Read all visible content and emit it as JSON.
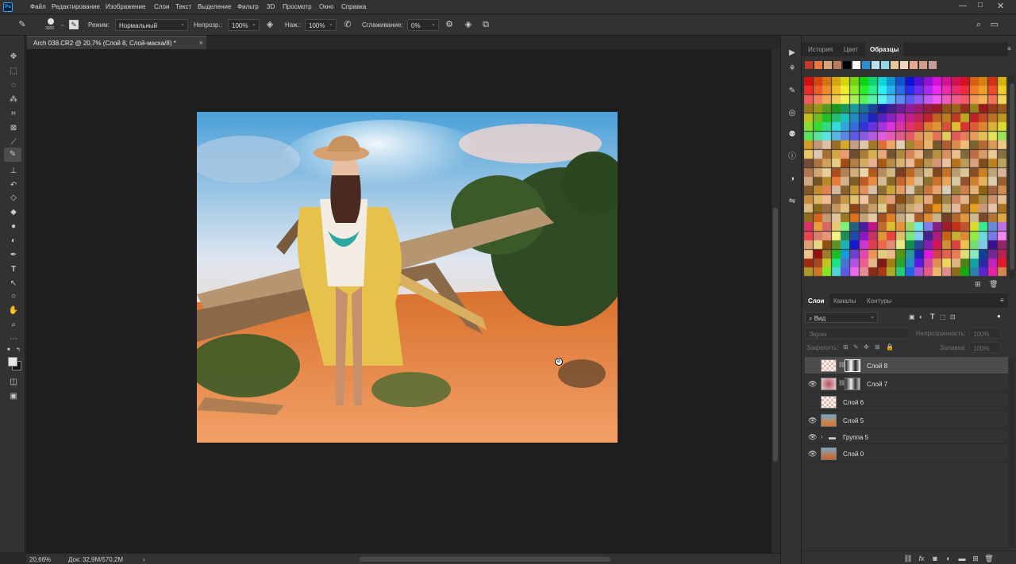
{
  "menubar": {
    "app_icon": "Ps",
    "items": [
      "Файл",
      "Редактирование",
      "Изображение",
      "Слои",
      "Текст",
      "Выделение",
      "Фильтр",
      "3D",
      "Просмотр",
      "Окно",
      "Справка"
    ],
    "window_controls": [
      "minimize-icon",
      "maximize-icon",
      "close-icon"
    ]
  },
  "options": {
    "brush_size": "3000",
    "mode_label": "Режим:",
    "mode_value": "Нормальный",
    "opacity_label": "Непрозр.:",
    "opacity_value": "100%",
    "flow_label": "Наж.:",
    "flow_value": "100%",
    "smoothing_label": "Сглаживание:",
    "smoothing_value": "0%"
  },
  "document": {
    "tab_title": "Arch 038.CR2 @ 20,7% (Слой 8, Слой-маска/8) *",
    "close_glyph": "×"
  },
  "status": {
    "zoom": "20,66%",
    "doc_size": "Док: 32,9M/570,2M",
    "arrow": "›"
  },
  "swatches_panel": {
    "tabs": [
      "История",
      "Цвет",
      "Образцы"
    ],
    "active_tab": "Образцы",
    "recent_colors": [
      "#c43a2a",
      "#e8783c",
      "#d8a478",
      "#b97c5a",
      "#000000",
      "#ffffff",
      "#2a8fd0",
      "#bcdff0",
      "#8fd6e8",
      "#e8c49a",
      "#f2d2b8",
      "#e8a88c",
      "#d49c8c",
      "#c89e9a"
    ]
  },
  "layers_panel": {
    "tabs": [
      "Слои",
      "Каналы",
      "Контуры"
    ],
    "active_tab": "Слои",
    "filter_value": "Вид",
    "blend_mode": "Экран",
    "opacity_label": "Непрозрачность:",
    "opacity_value": "100%",
    "lock_label": "Закрепить:",
    "fill_label": "Заливка:",
    "fill_value": "100%",
    "layers": [
      {
        "name": "Слой 8",
        "visible": false,
        "selected": true,
        "mask": true
      },
      {
        "name": "Слой 7",
        "visible": true,
        "selected": false,
        "mask": true
      },
      {
        "name": "Слой 6",
        "visible": false,
        "selected": false,
        "mask": false
      },
      {
        "name": "Слой 5",
        "visible": true,
        "selected": false,
        "mask": false
      },
      {
        "name": "Группа 5",
        "visible": true,
        "selected": false,
        "mask": false,
        "group": true
      },
      {
        "name": "Слой 0",
        "visible": true,
        "selected": false,
        "mask": false
      }
    ]
  },
  "colors": {
    "accent": "#31a8ff",
    "panel": "#323232",
    "canvas_bg": "#1e1e1e"
  }
}
